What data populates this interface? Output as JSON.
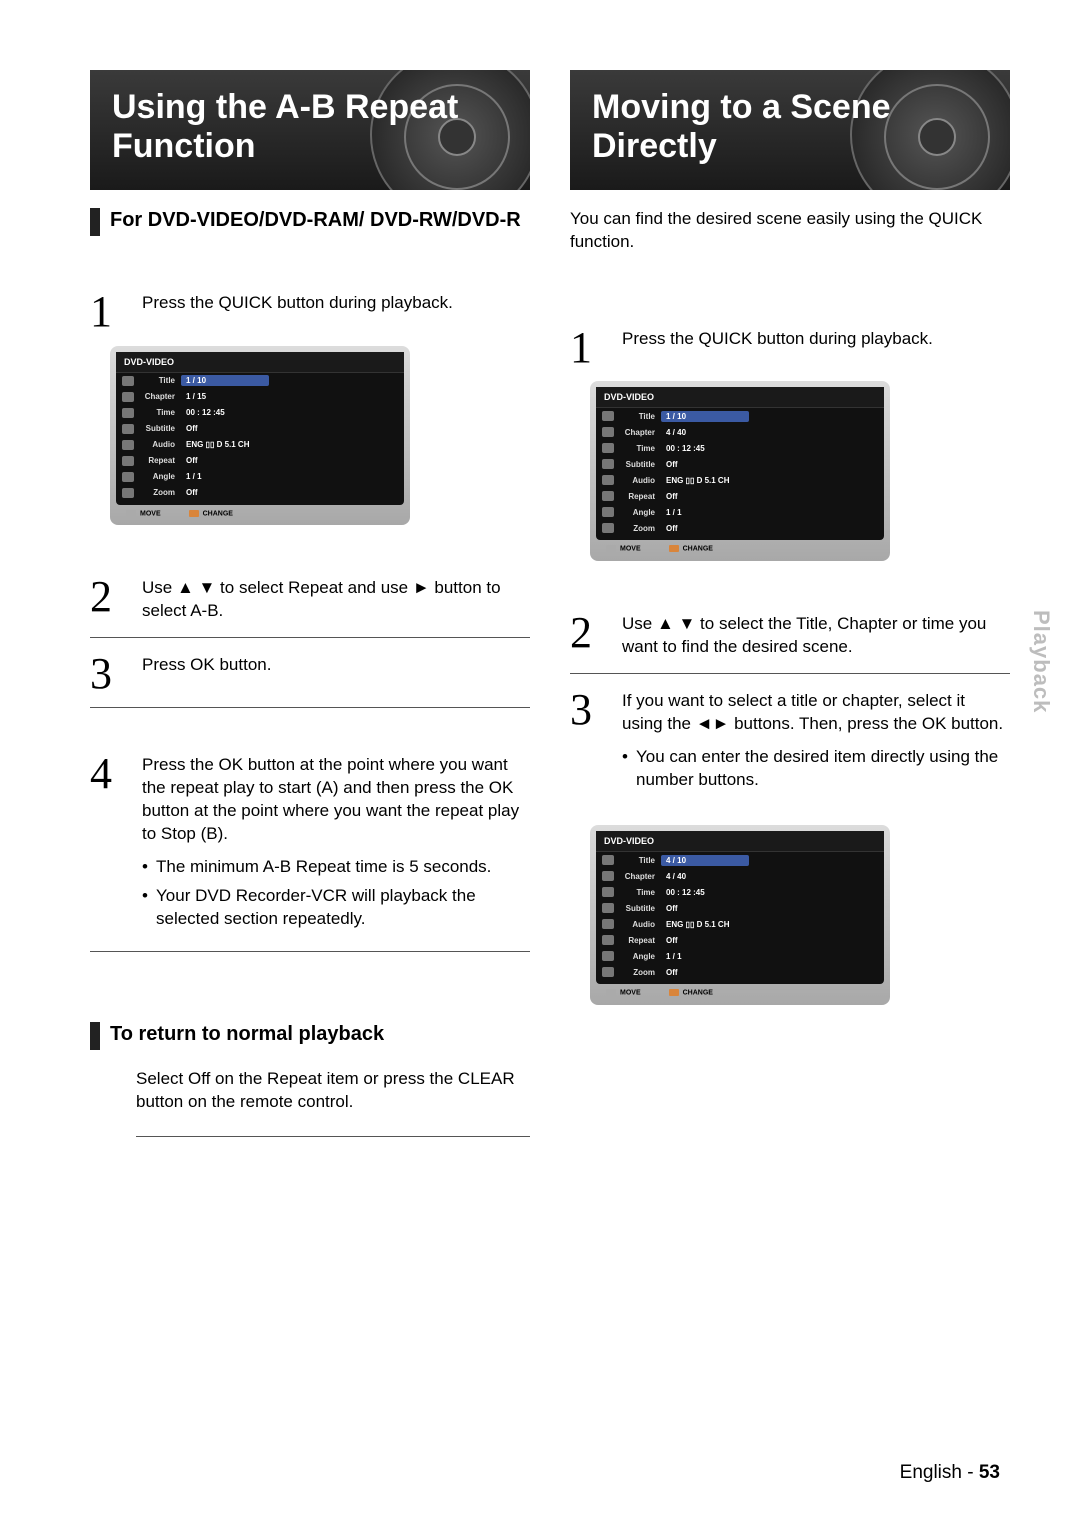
{
  "sideTab": "Playback",
  "footer": {
    "lang": "English - ",
    "page": "53"
  },
  "left": {
    "heroTitle": "Using the A-B Repeat Function",
    "subHeading": "For DVD-VIDEO/DVD-RAM/ DVD-RW/DVD-R",
    "steps": [
      {
        "n": "1",
        "text": "Press the QUICK button during playback."
      },
      {
        "n": "2",
        "text": "Use ▲ ▼ to select Repeat and use ► button to select A-B."
      },
      {
        "n": "3",
        "text": "Press OK button."
      },
      {
        "n": "4",
        "text": "Press the OK button at the point where you want the repeat play to start (A) and then press the OK button at the point where you want the repeat play to Stop (B).",
        "bullets": [
          "The minimum A-B Repeat time is 5 seconds.",
          "Your DVD Recorder-VCR will playback the selected section repeatedly."
        ]
      }
    ],
    "osd": {
      "header": "DVD-VIDEO",
      "rows": [
        {
          "label": "Title",
          "value": "1 / 10",
          "sel": true
        },
        {
          "label": "Chapter",
          "value": "1 / 15"
        },
        {
          "label": "Time",
          "value": "00 : 12 :45"
        },
        {
          "label": "Subtitle",
          "value": "Off"
        },
        {
          "label": "Audio",
          "value": "ENG ▯▯ D 5.1 CH"
        },
        {
          "label": "Repeat",
          "value": "Off"
        },
        {
          "label": "Angle",
          "value": "1 / 1"
        },
        {
          "label": "Zoom",
          "value": "Off"
        }
      ],
      "footer": {
        "move": "MOVE",
        "change": "CHANGE"
      }
    },
    "returnHeading": "To return to normal playback",
    "returnBody": "Select Off on the Repeat item or press the CLEAR button on the remote control."
  },
  "right": {
    "heroTitle": "Moving to a Scene Directly",
    "intro": "You can find the desired scene easily using the QUICK function.",
    "steps": [
      {
        "n": "1",
        "text": "Press the QUICK button during playback."
      },
      {
        "n": "2",
        "text": "Use ▲ ▼ to select the Title, Chapter or time you want to find the desired scene."
      },
      {
        "n": "3",
        "text": "If you want to select a title or chapter, select it using the ◄► buttons. Then, press the OK button.",
        "bullets": [
          "You can enter the desired item directly using the number buttons."
        ]
      }
    ],
    "osd1": {
      "header": "DVD-VIDEO",
      "rows": [
        {
          "label": "Title",
          "value": "1 / 10",
          "sel": true
        },
        {
          "label": "Chapter",
          "value": "4 / 40"
        },
        {
          "label": "Time",
          "value": "00 : 12 :45"
        },
        {
          "label": "Subtitle",
          "value": "Off"
        },
        {
          "label": "Audio",
          "value": "ENG ▯▯ D 5.1 CH"
        },
        {
          "label": "Repeat",
          "value": "Off"
        },
        {
          "label": "Angle",
          "value": "1 / 1"
        },
        {
          "label": "Zoom",
          "value": "Off"
        }
      ],
      "footer": {
        "move": "MOVE",
        "change": "CHANGE"
      }
    },
    "osd2": {
      "header": "DVD-VIDEO",
      "rows": [
        {
          "label": "Title",
          "value": "4 / 10",
          "sel": true
        },
        {
          "label": "Chapter",
          "value": "4 / 40"
        },
        {
          "label": "Time",
          "value": "00 : 12 :45"
        },
        {
          "label": "Subtitle",
          "value": "Off"
        },
        {
          "label": "Audio",
          "value": "ENG ▯▯ D 5.1 CH"
        },
        {
          "label": "Repeat",
          "value": "Off"
        },
        {
          "label": "Angle",
          "value": "1 / 1"
        },
        {
          "label": "Zoom",
          "value": "Off"
        }
      ],
      "footer": {
        "move": "MOVE",
        "change": "CHANGE"
      }
    }
  }
}
